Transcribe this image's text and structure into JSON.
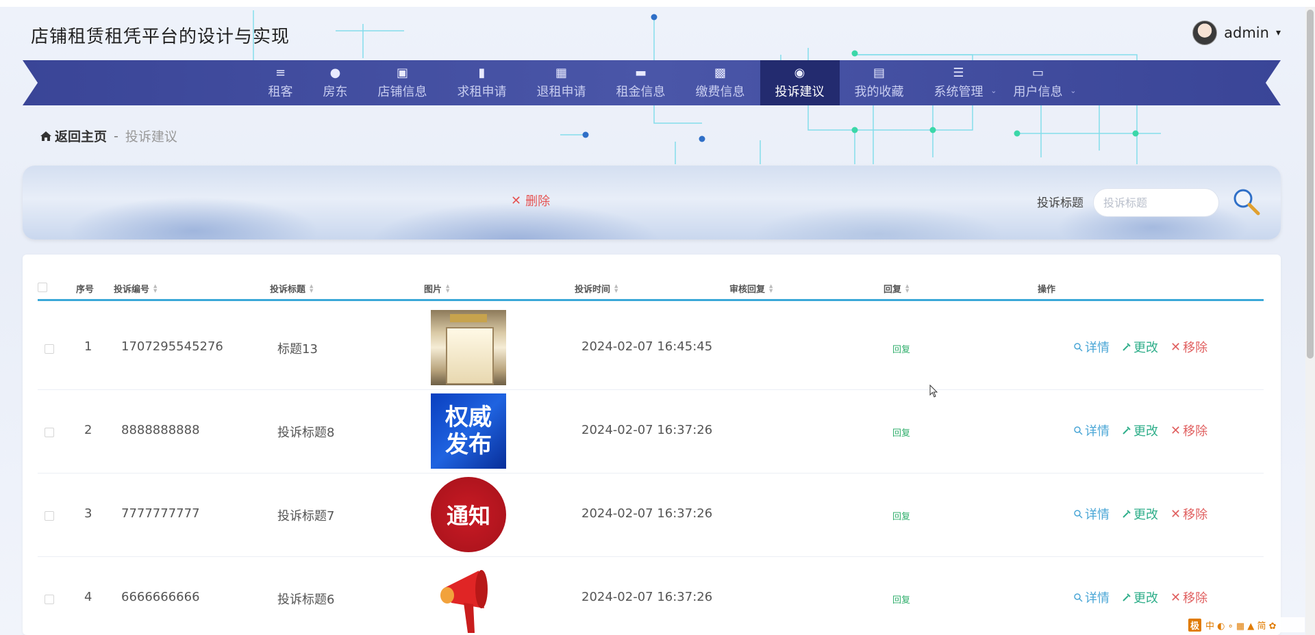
{
  "site": {
    "title": "店铺租赁租凭平台的设计与实现"
  },
  "user": {
    "name": "admin",
    "caret": "▾"
  },
  "nav": {
    "items": [
      {
        "label": "租客",
        "icon": "≡"
      },
      {
        "label": "房东",
        "icon": "●"
      },
      {
        "label": "店铺信息",
        "icon": "▣"
      },
      {
        "label": "求租申请",
        "icon": "▮"
      },
      {
        "label": "退租申请",
        "icon": "▦"
      },
      {
        "label": "租金信息",
        "icon": "▬"
      },
      {
        "label": "缴费信息",
        "icon": "▩"
      },
      {
        "label": "投诉建议",
        "icon": "◉"
      },
      {
        "label": "我的收藏",
        "icon": "▤"
      },
      {
        "label": "系统管理",
        "icon": "☰",
        "dropdown": "⌄"
      },
      {
        "label": "用户信息",
        "icon": "▭",
        "dropdown": "⌄"
      }
    ],
    "active_label": "投诉建议"
  },
  "breadcrumb": {
    "home": "返回主页",
    "separator": "-",
    "current": "投诉建议"
  },
  "toolbar": {
    "delete_label": "删除",
    "delete_icon": "✕"
  },
  "search": {
    "label": "投诉标题",
    "placeholder": "投诉标题",
    "value": ""
  },
  "table": {
    "headers": [
      "序号",
      "投诉编号",
      "投诉标题",
      "图片",
      "投诉时间",
      "审核回复",
      "回复",
      "操作"
    ],
    "rows": [
      {
        "index": "1",
        "code": "1707295545276",
        "title": "标题13",
        "image": "shop",
        "time": "2024-02-07 16:45:45",
        "review": "",
        "reply": "回复"
      },
      {
        "index": "2",
        "code": "8888888888",
        "title": "投诉标题8",
        "image": "authority",
        "image_text_top": "权威",
        "image_text_bottom": "发布",
        "time": "2024-02-07 16:37:26",
        "review": "",
        "reply": "回复"
      },
      {
        "index": "3",
        "code": "7777777777",
        "title": "投诉标题7",
        "image": "notice",
        "image_text": "通知",
        "time": "2024-02-07 16:37:26",
        "review": "",
        "reply": "回复"
      },
      {
        "index": "4",
        "code": "6666666666",
        "title": "投诉标题6",
        "image": "horn",
        "time": "2024-02-07 16:37:26",
        "review": "",
        "reply": "回复"
      }
    ],
    "actions": {
      "detail": "详情",
      "edit": "更改",
      "remove": "移除"
    }
  },
  "ime": {
    "logo": "极",
    "items": "中 ◐ ∘ ▦ ▲ 简 ✿"
  },
  "colors": {
    "nav_bg": "#3a4597",
    "nav_active": "#232b6f",
    "accent_line": "#3aa8d8",
    "delete": "#e55353",
    "reply": "#2fae6b"
  }
}
